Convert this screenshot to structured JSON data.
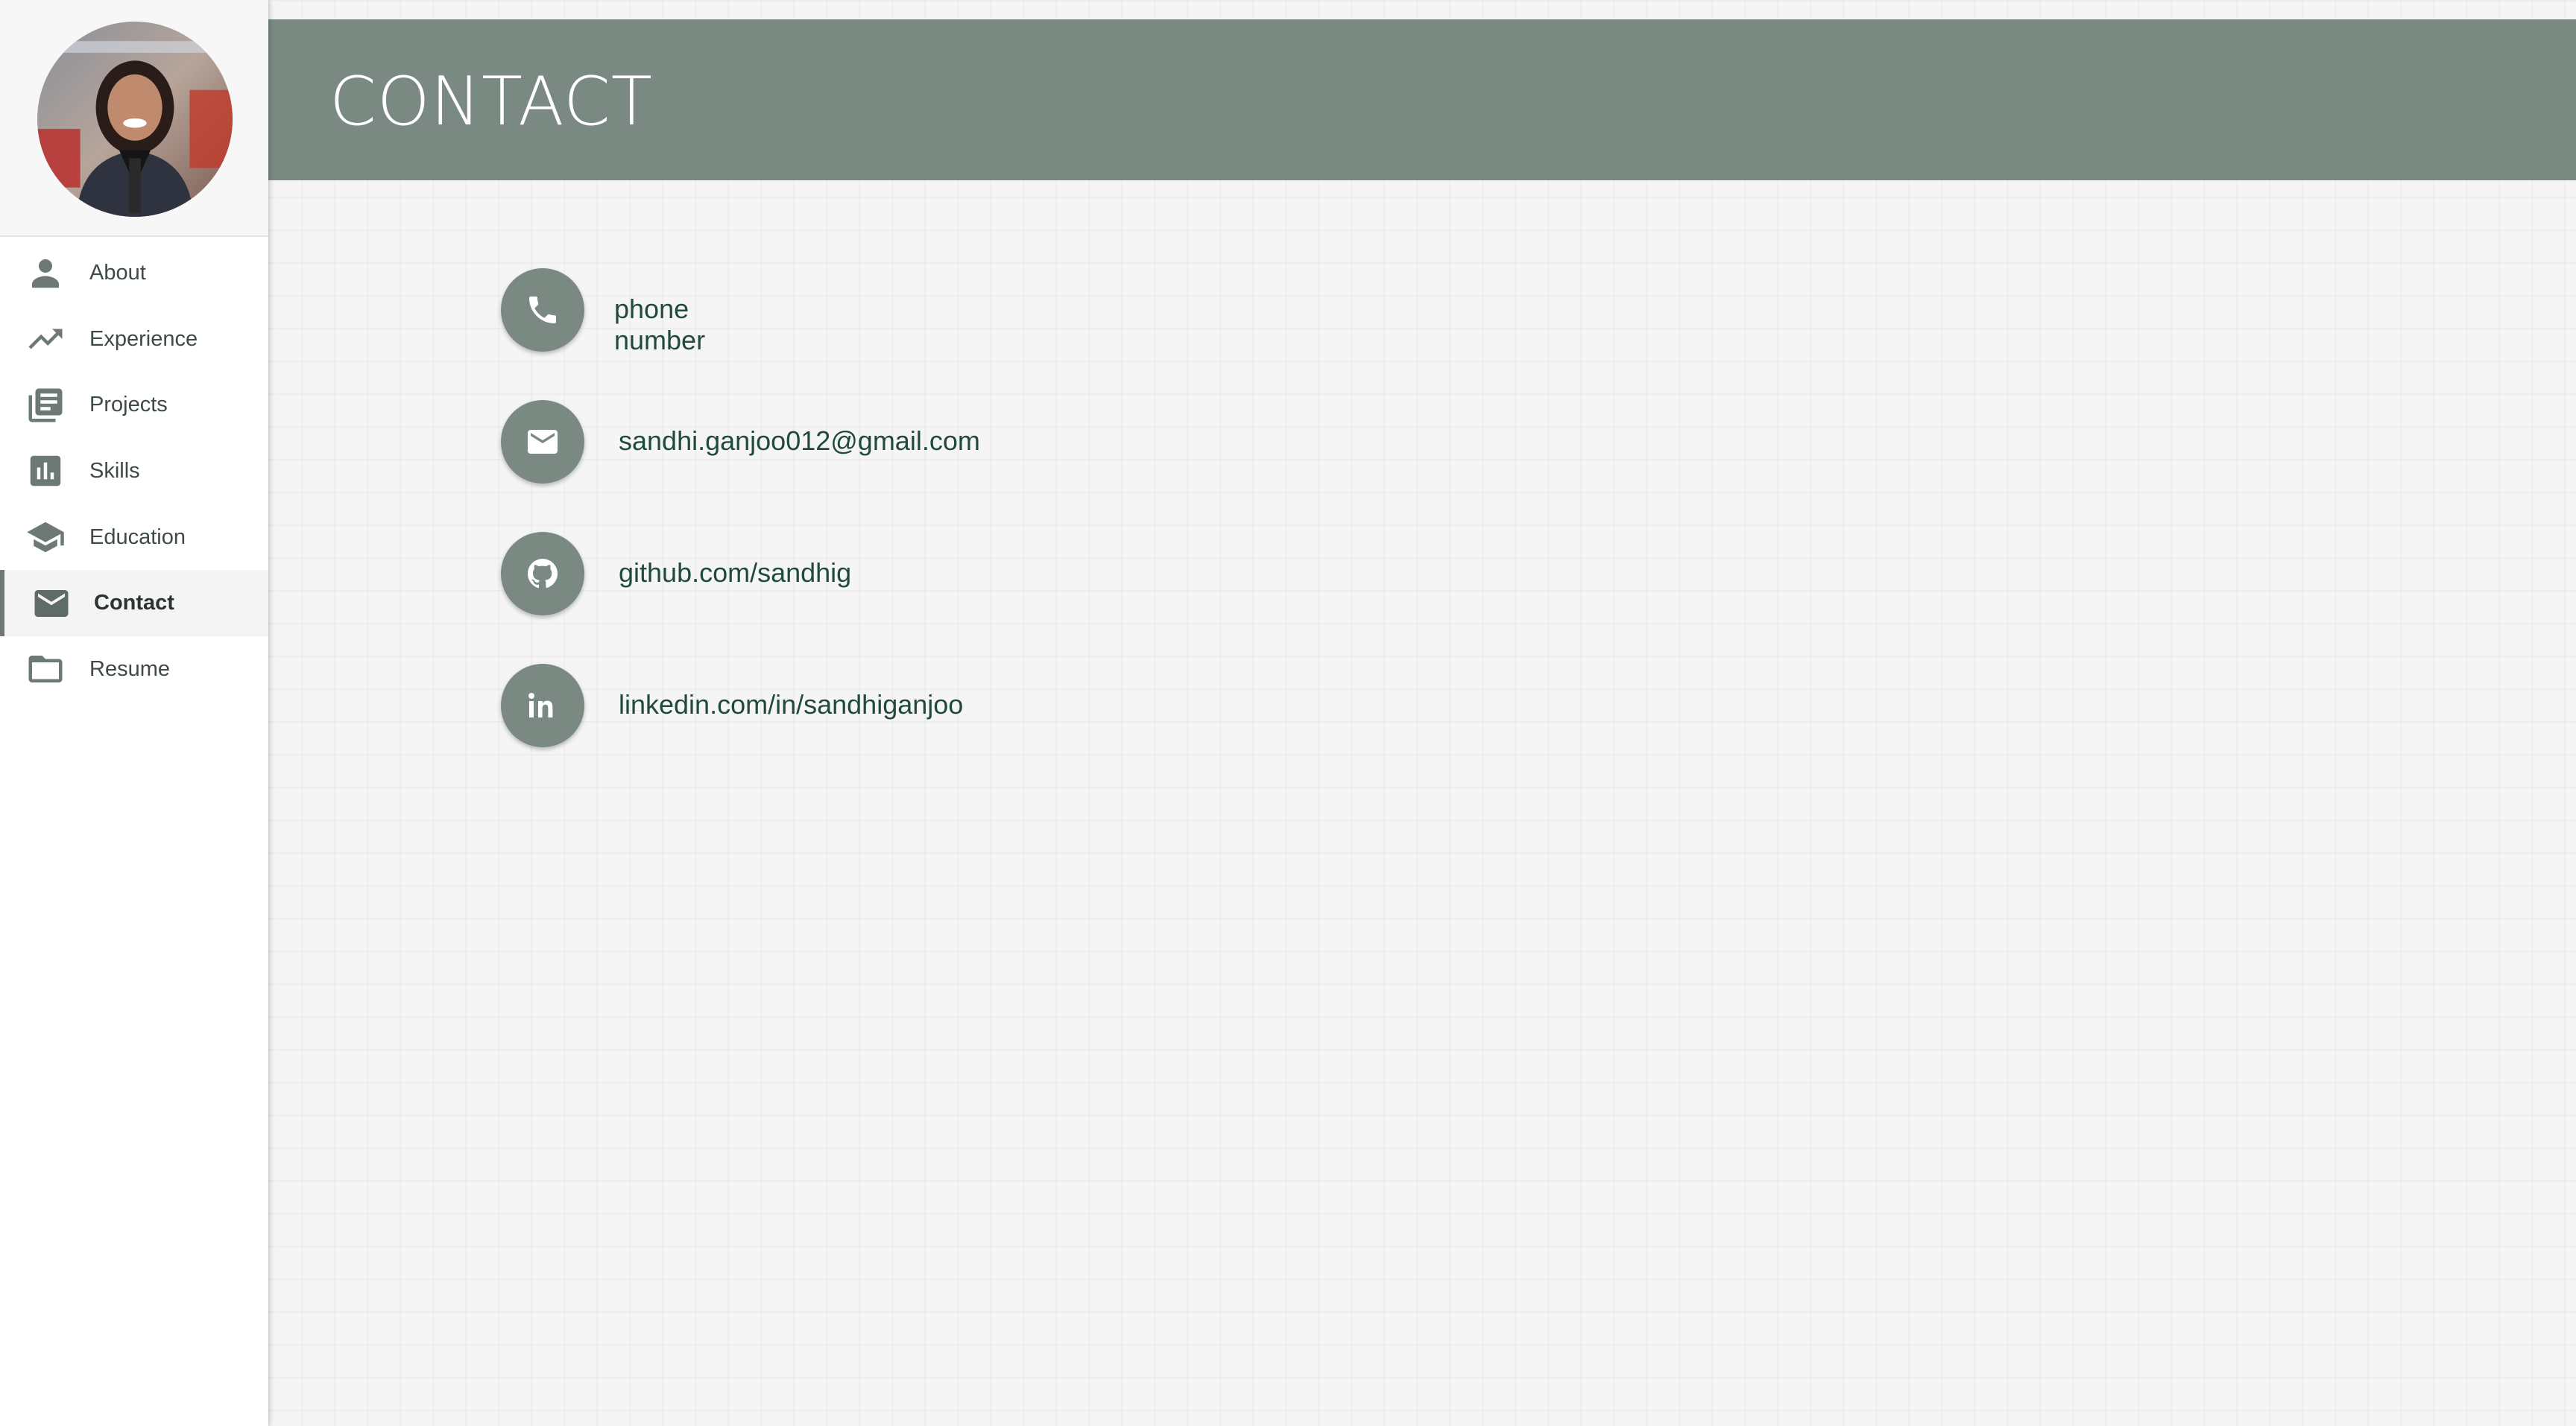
{
  "sidebar": {
    "nav_items": [
      {
        "label": "About",
        "icon": "person-icon"
      },
      {
        "label": "Experience",
        "icon": "trending-up-icon"
      },
      {
        "label": "Projects",
        "icon": "projects-icon"
      },
      {
        "label": "Skills",
        "icon": "bar-chart-icon"
      },
      {
        "label": "Education",
        "icon": "graduation-cap-icon"
      },
      {
        "label": "Contact",
        "icon": "envelope-icon",
        "active": true
      },
      {
        "label": "Resume",
        "icon": "folder-icon"
      }
    ]
  },
  "header": {
    "title": "CONTACT"
  },
  "contacts": [
    {
      "text": "phone number",
      "icon": "phone-icon"
    },
    {
      "text": "sandhi.ganjoo012@gmail.com",
      "icon": "envelope-icon"
    },
    {
      "text": "github.com/sandhig",
      "icon": "github-icon"
    },
    {
      "text": "linkedin.com/in/sandhiganjoo",
      "icon": "linkedin-icon"
    }
  ],
  "colors": {
    "accent": "#7a8a83",
    "link_text": "#1f4a3c",
    "background": "#f5f5f5"
  }
}
